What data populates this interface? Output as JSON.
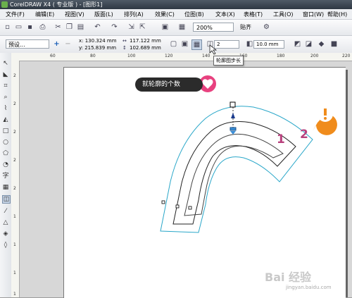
{
  "app": {
    "title": "CorelDRAW X4 ( 专业版 ) - [图形1]"
  },
  "menu": {
    "items": [
      {
        "label": "文件(F)"
      },
      {
        "label": "编辑(E)"
      },
      {
        "label": "视图(V)"
      },
      {
        "label": "版面(L)"
      },
      {
        "label": "排列(A)"
      },
      {
        "label": "效果(C)"
      },
      {
        "label": "位图(B)"
      },
      {
        "label": "文本(X)"
      },
      {
        "label": "表格(T)"
      },
      {
        "label": "工具(O)"
      },
      {
        "label": "窗口(W)"
      },
      {
        "label": "帮助(H)"
      }
    ]
  },
  "toolbar": {
    "zoom": "200%",
    "snap": "贴齐"
  },
  "propbar": {
    "preset": "预设...",
    "x": "x: 130.324 mm",
    "y": "y: 215.839 mm",
    "width": "117.122 mm",
    "height": "102.689 mm",
    "steps": "2",
    "offset": "10.0 mm"
  },
  "tooltip": "轮廓图步长",
  "callout": "就轮廓的个数",
  "annotations": {
    "label1": "1",
    "label2": "2"
  },
  "ruler": {
    "h": [
      "60",
      "80",
      "100",
      "120",
      "140",
      "160",
      "180",
      "200",
      "220"
    ],
    "v": [
      "2",
      "2",
      "2",
      "2",
      "2",
      "1",
      "1",
      "1",
      "1"
    ]
  },
  "watermark": {
    "text": "Bai 经验",
    "sub": "jingyan.baidu.com"
  },
  "colors": {
    "outline": "#2aa7c9",
    "callout_heart": "#e8417f",
    "alert": "#f08c1c",
    "label": "#b8417d"
  }
}
